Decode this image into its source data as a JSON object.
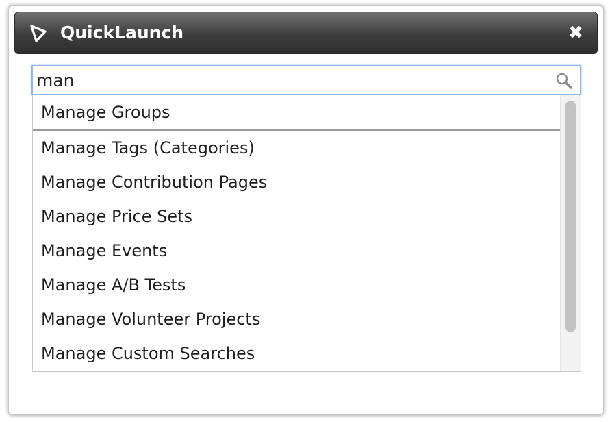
{
  "dialog": {
    "title": "QuickLaunch",
    "logo_icon": "triangle-play-icon",
    "close_icon": "close-icon",
    "close_symbol": "✖"
  },
  "search": {
    "value": "man",
    "icon": "search-icon"
  },
  "results": [
    {
      "label": "Manage Groups"
    },
    {
      "label": "Manage Tags (Categories)"
    },
    {
      "label": "Manage Contribution Pages"
    },
    {
      "label": "Manage Price Sets"
    },
    {
      "label": "Manage Events"
    },
    {
      "label": "Manage A/B Tests"
    },
    {
      "label": "Manage Volunteer Projects"
    },
    {
      "label": "Manage Custom Searches"
    }
  ],
  "colors": {
    "titlebar_top": "#6f6f6f",
    "titlebar_bottom": "#2e2e2e",
    "focus_border": "#8fb8e8",
    "scrollbar_thumb": "#c2c2c2"
  }
}
